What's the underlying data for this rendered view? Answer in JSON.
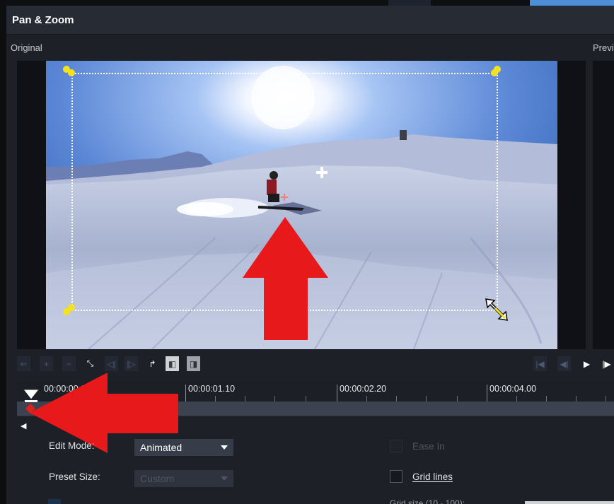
{
  "window": {
    "title": "Pan & Zoom"
  },
  "panels": {
    "original_label": "Original",
    "preview_label": "Previ"
  },
  "toolbar": {
    "buttons": [
      {
        "name": "move-left-icon",
        "glyph": "⇐",
        "enabled": false
      },
      {
        "name": "move-up-icon",
        "glyph": "+",
        "enabled": false
      },
      {
        "name": "zoom-out-icon",
        "glyph": "−",
        "enabled": false
      },
      {
        "name": "fit-icon",
        "glyph": "⤡",
        "enabled": true
      },
      {
        "name": "prev-keyframe-icon",
        "glyph": "◁|",
        "enabled": false
      },
      {
        "name": "next-keyframe-icon",
        "glyph": "|▷",
        "enabled": false
      },
      {
        "name": "reverse-icon",
        "glyph": "↱",
        "enabled": true
      },
      {
        "name": "copy-keyframe-icon",
        "glyph": "◧",
        "enabled": true
      },
      {
        "name": "paste-keyframe-icon",
        "glyph": "◨",
        "enabled": true
      }
    ],
    "playback": [
      {
        "name": "goto-start-icon",
        "glyph": "|◀",
        "enabled": false
      },
      {
        "name": "step-back-icon",
        "glyph": "◀|",
        "enabled": false
      },
      {
        "name": "play-icon",
        "glyph": "▶",
        "enabled": true
      },
      {
        "name": "step-forward-icon",
        "glyph": "|▶",
        "enabled": true
      }
    ]
  },
  "timeline": {
    "labels": [
      "00:00:00.00",
      "00:00:01.10",
      "00:00:02.20",
      "00:00:04.00"
    ],
    "playhead_time": "00:00:00.00"
  },
  "form": {
    "edit_mode_label": "Edit Mode:",
    "edit_mode_value": "Animated",
    "preset_size_label": "Preset Size:",
    "preset_size_value": "Custom",
    "ease_in_label": "Ease In",
    "grid_lines_label": "Grid lines",
    "grid_size_label": "Grid size (10 - 100):"
  },
  "colors": {
    "accent": "#4d8fd6",
    "handle": "#f5e21e",
    "annotation_arrow": "#e8191b",
    "keyframe": "#d9231d"
  }
}
